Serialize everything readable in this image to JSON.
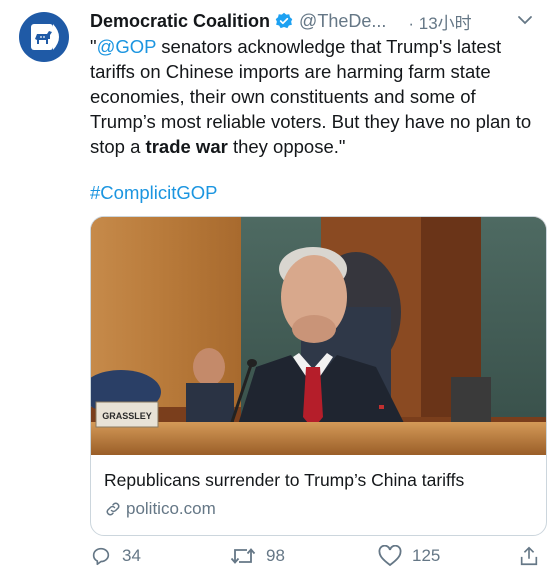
{
  "tweet": {
    "display_name": "Democratic Coalition",
    "handle": "@TheDe...",
    "time": "· 13小时",
    "text_parts": [
      "\"",
      "@GOP",
      " senators acknowledge that Trump's latest tariffs on Chinese imports are harming farm state economies, their own constituents and some of Trump’s most reliable voters. But they have no plan to stop a ",
      "trade war",
      " they oppose.\""
    ],
    "hashtag": "#ComplicitGOP"
  },
  "card": {
    "title": "Republicans surrender to Trump’s China tariffs",
    "domain": "politico.com",
    "nameplate": "GRASSLEY"
  },
  "actions": {
    "replies": "34",
    "retweets": "98",
    "likes": "125"
  },
  "colors": {
    "link": "#1b95e0",
    "secondary_text": "#657786",
    "avatar_bg": "#1f5aa6"
  },
  "icons": [
    "verified-badge-icon",
    "chevron-down-icon",
    "link-icon",
    "reply-icon",
    "retweet-icon",
    "like-icon",
    "share-icon"
  ]
}
